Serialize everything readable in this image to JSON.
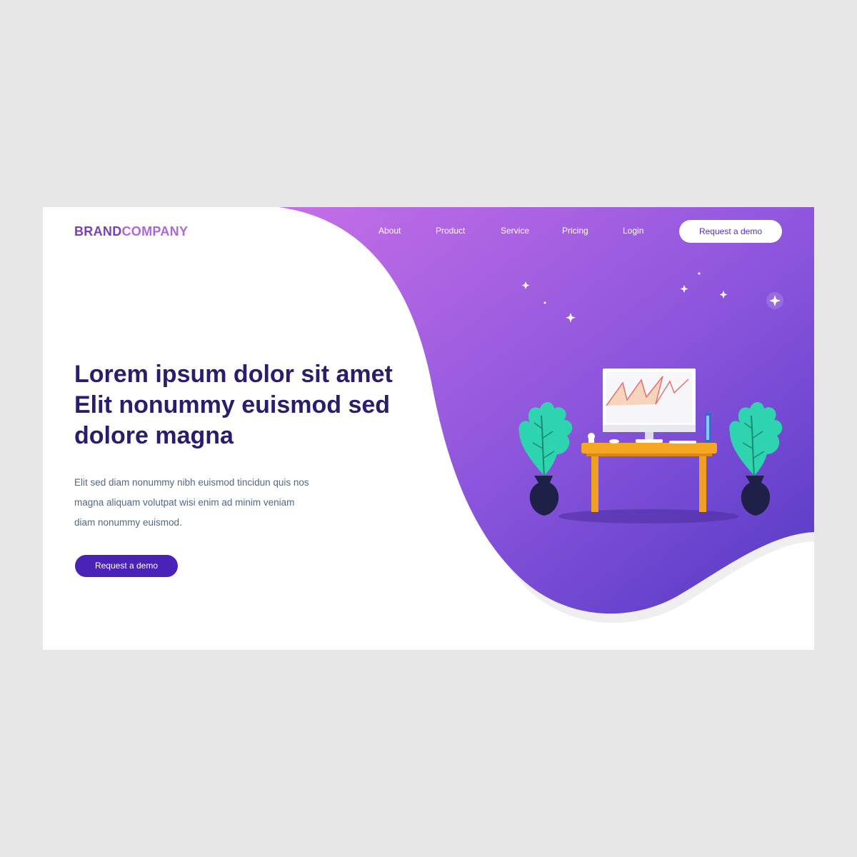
{
  "brand": {
    "part1": "BRAND",
    "part2": "COMPANY"
  },
  "nav": {
    "items": [
      {
        "label": "About"
      },
      {
        "label": "Product"
      },
      {
        "label": "Service"
      },
      {
        "label": "Pricing"
      },
      {
        "label": "Login"
      }
    ],
    "cta_label": "Request a demo"
  },
  "hero": {
    "headline_lines": [
      "Lorem ipsum dolor sit amet",
      "Elit nonummy euismod sed",
      "dolore magna"
    ],
    "paragraph_lines": [
      "Elit sed diam nonummy nibh euismod tincidun quis nos",
      "magna aliquam  volutpat wisi enim ad minim veniam",
      "diam nonummy euismod."
    ],
    "cta_label": "Request a demo"
  },
  "colors": {
    "page_bg": "#e7e7e8",
    "gradient_start": "#c16ee6",
    "gradient_mid": "#8d55db",
    "gradient_end": "#5a3fc8",
    "headline": "#2b1d6b",
    "paragraph": "#506a86",
    "button_primary": "#4a22b8",
    "plant_leaf": "#2ed3b0",
    "table": "#f5a623"
  },
  "illustration": {
    "description_icons": [
      "star-icon",
      "monitor-icon",
      "line-chart-icon",
      "plant-icon",
      "vase-icon",
      "desk-icon"
    ]
  }
}
